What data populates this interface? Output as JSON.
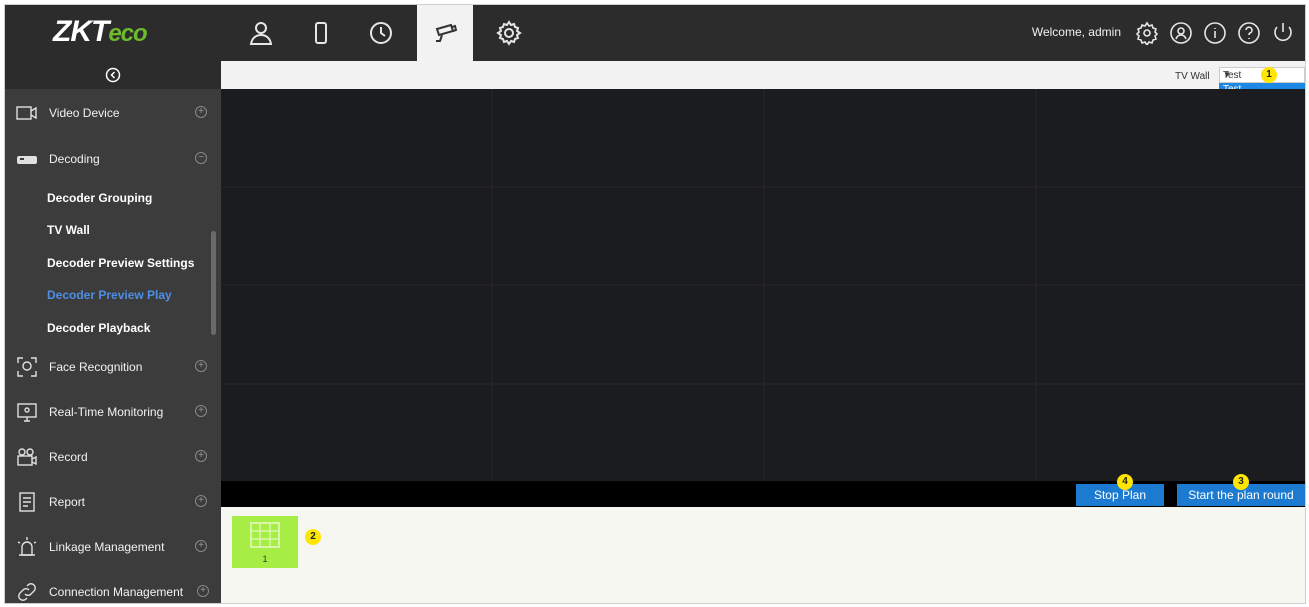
{
  "app": {
    "logo_main": "ZKT",
    "logo_accent": "eco"
  },
  "header": {
    "welcome": "Welcome, admin",
    "nav_icons": [
      "person-icon",
      "door-icon",
      "clock-icon",
      "camera-icon",
      "gear-icon"
    ],
    "right_icons": [
      "settings-icon",
      "user-circle-icon",
      "info-icon",
      "help-icon",
      "power-icon"
    ],
    "active_nav": "camera-icon"
  },
  "sidebar": {
    "items": [
      {
        "label": "Video Device",
        "icon": "video-device-icon",
        "expanded": false
      },
      {
        "label": "Decoding",
        "icon": "decoding-icon",
        "expanded": true
      },
      {
        "label": "Face Recognition",
        "icon": "face-icon",
        "expanded": false
      },
      {
        "label": "Real-Time Monitoring",
        "icon": "monitor-icon",
        "expanded": false
      },
      {
        "label": "Record",
        "icon": "record-icon",
        "expanded": false
      },
      {
        "label": "Report",
        "icon": "report-icon",
        "expanded": false
      },
      {
        "label": "Linkage Management",
        "icon": "alarm-icon",
        "expanded": false
      },
      {
        "label": "Connection Management",
        "icon": "link-icon",
        "expanded": false
      }
    ],
    "sub_items": [
      {
        "label": "Decoder Grouping"
      },
      {
        "label": "TV Wall"
      },
      {
        "label": "Decoder Preview Settings"
      },
      {
        "label": "Decoder Preview Play",
        "active": true
      },
      {
        "label": "Decoder Playback"
      }
    ]
  },
  "toolbar": {
    "tvwall_label": "TV Wall",
    "tvwall_value": "Test",
    "dropdown_option": "Test"
  },
  "actions": {
    "stop_plan": "Stop Plan",
    "start_round": "Start the plan round"
  },
  "plans": [
    {
      "label": "1"
    }
  ],
  "badges": [
    "1",
    "2",
    "3",
    "4"
  ],
  "colors": {
    "topbar": "#2c2c2c",
    "sidebar": "#3c3c3c",
    "active_sub": "#4d8fe6",
    "button": "#1c7bd0",
    "plan_thumb": "#a6ee46",
    "badge": "#ffe600"
  }
}
